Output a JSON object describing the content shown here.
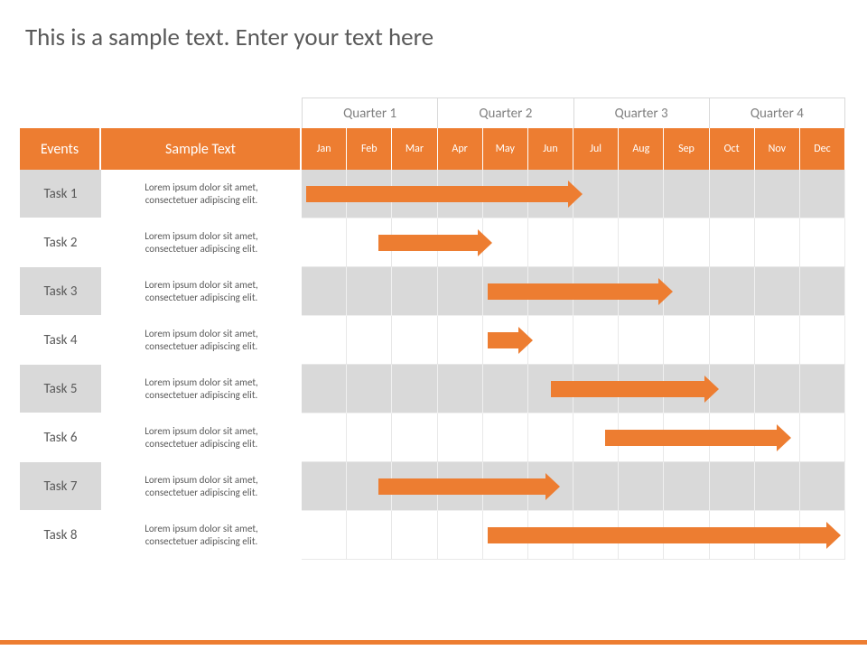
{
  "title": "This is a sample text. Enter your text here",
  "headers": {
    "events": "Events",
    "sample": "Sample Text"
  },
  "quarters": [
    "Quarter 1",
    "Quarter 2",
    "Quarter 3",
    "Quarter 4"
  ],
  "months": [
    "Jan",
    "Feb",
    "Mar",
    "Apr",
    "May",
    "Jun",
    "Jul",
    "Aug",
    "Sep",
    "Oct",
    "Nov",
    "Dec"
  ],
  "tasks": [
    {
      "label": "Task 1",
      "desc1": "Lorem ipsum dolor sit amet,",
      "desc2": "consectetuer adipiscing elit."
    },
    {
      "label": "Task 2",
      "desc1": "Lorem ipsum dolor sit amet,",
      "desc2": "consectetuer adipiscing elit."
    },
    {
      "label": "Task 3",
      "desc1": "Lorem ipsum dolor sit amet,",
      "desc2": "consectetuer adipiscing elit."
    },
    {
      "label": "Task 4",
      "desc1": "Lorem ipsum dolor sit amet,",
      "desc2": "consectetuer adipiscing elit."
    },
    {
      "label": "Task 5",
      "desc1": "Lorem ipsum dolor sit amet,",
      "desc2": "consectetuer adipiscing elit."
    },
    {
      "label": "Task 6",
      "desc1": "Lorem ipsum dolor sit amet,",
      "desc2": "consectetuer adipiscing elit."
    },
    {
      "label": "Task 7",
      "desc1": "Lorem ipsum dolor sit amet,",
      "desc2": "consectetuer adipiscing elit."
    },
    {
      "label": "Task 8",
      "desc1": "Lorem ipsum dolor sit amet,",
      "desc2": "consectetuer adipiscing elit."
    }
  ],
  "chart_data": {
    "type": "gantt",
    "title": "This is a sample text. Enter your text here",
    "x_categories": [
      "Jan",
      "Feb",
      "Mar",
      "Apr",
      "May",
      "Jun",
      "Jul",
      "Aug",
      "Sep",
      "Oct",
      "Nov",
      "Dec"
    ],
    "x_groups": [
      {
        "label": "Quarter 1",
        "span": [
          "Jan",
          "Mar"
        ]
      },
      {
        "label": "Quarter 2",
        "span": [
          "Apr",
          "Jun"
        ]
      },
      {
        "label": "Quarter 3",
        "span": [
          "Jul",
          "Sep"
        ]
      },
      {
        "label": "Quarter 4",
        "span": [
          "Oct",
          "Dec"
        ]
      }
    ],
    "series": [
      {
        "name": "Task 1",
        "start": 0.1,
        "end": 6.2
      },
      {
        "name": "Task 2",
        "start": 1.7,
        "end": 4.2
      },
      {
        "name": "Task 3",
        "start": 4.1,
        "end": 8.2
      },
      {
        "name": "Task 4",
        "start": 4.1,
        "end": 5.1
      },
      {
        "name": "Task 5",
        "start": 5.5,
        "end": 9.2
      },
      {
        "name": "Task 6",
        "start": 6.7,
        "end": 10.8
      },
      {
        "name": "Task 7",
        "start": 1.7,
        "end": 5.7
      },
      {
        "name": "Task 8",
        "start": 4.1,
        "end": 11.9
      }
    ],
    "xlim": [
      0,
      12
    ],
    "color": "#ed7d31"
  }
}
